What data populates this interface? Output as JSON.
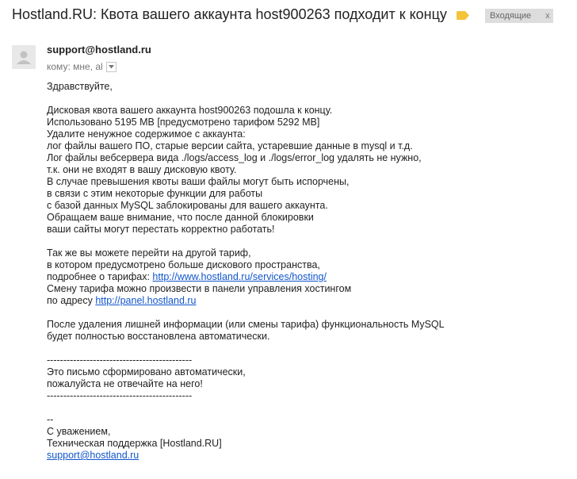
{
  "header": {
    "subject": "Hostland.RU: Квота вашего аккаунта host900263 подходит к концу",
    "label_tag_color": "#f3c43a",
    "inbox_label": "Входящие",
    "inbox_close": "x"
  },
  "message": {
    "sender": "support@hostland.ru",
    "recipients": "кому: мне, al",
    "avatar_icon": "person-icon",
    "greeting": "Здравствуйте,",
    "p1": [
      "Дисковая квота вашего аккаунта host900263 подошла к концу.",
      "Использовано 5195 MB [предусмотрено тарифом 5292 MB]",
      "Удалите ненужное содержимое с аккаунта:",
      "лог файлы вашего ПО, старые версии сайта, устаревшие данные в mysql и т.д.",
      "Лог файлы вебсервера вида ./logs/access_log и ./logs/error_log удалять не нужно,",
      "т.к. они не входят в вашу дисковую квоту.",
      "В случае превышения квоты ваши файлы могут быть испорчены,",
      "в связи с этим некоторые функции для работы",
      "с базой данных MySQL заблокированы для вашего аккаунта.",
      "Обращаем ваше внимание, что после данной блокировки",
      "ваши сайты могут перестать корректно работать!"
    ],
    "p2": {
      "l1": "Так же вы можете перейти на другой тариф,",
      "l2": "в котором предусмотрено больше дискового пространства,",
      "l3_prefix": "подробнее о тарифах: ",
      "l3_link": "http://www.hostland.ru/services/hosting/",
      "l4": "Смену тарифа можно произвести в панели управления хостингом",
      "l5_prefix": "по адресу ",
      "l5_link": "http://panel.hostland.ru"
    },
    "p3": [
      "После удаления лишней информации (или смены тарифа) функциональность MySQL",
      "будет полностью восстановлена автоматически."
    ],
    "separator": "--------------------------------------------",
    "auto_notice": [
      "Это письмо сформировано автоматически,",
      "пожалуйста не отвечайте на него!"
    ],
    "sig_dash": "--",
    "regards": "С уважением,",
    "team": "Техническая поддержка [Hostland.RU]",
    "sig_email": "support@hostland.ru"
  }
}
